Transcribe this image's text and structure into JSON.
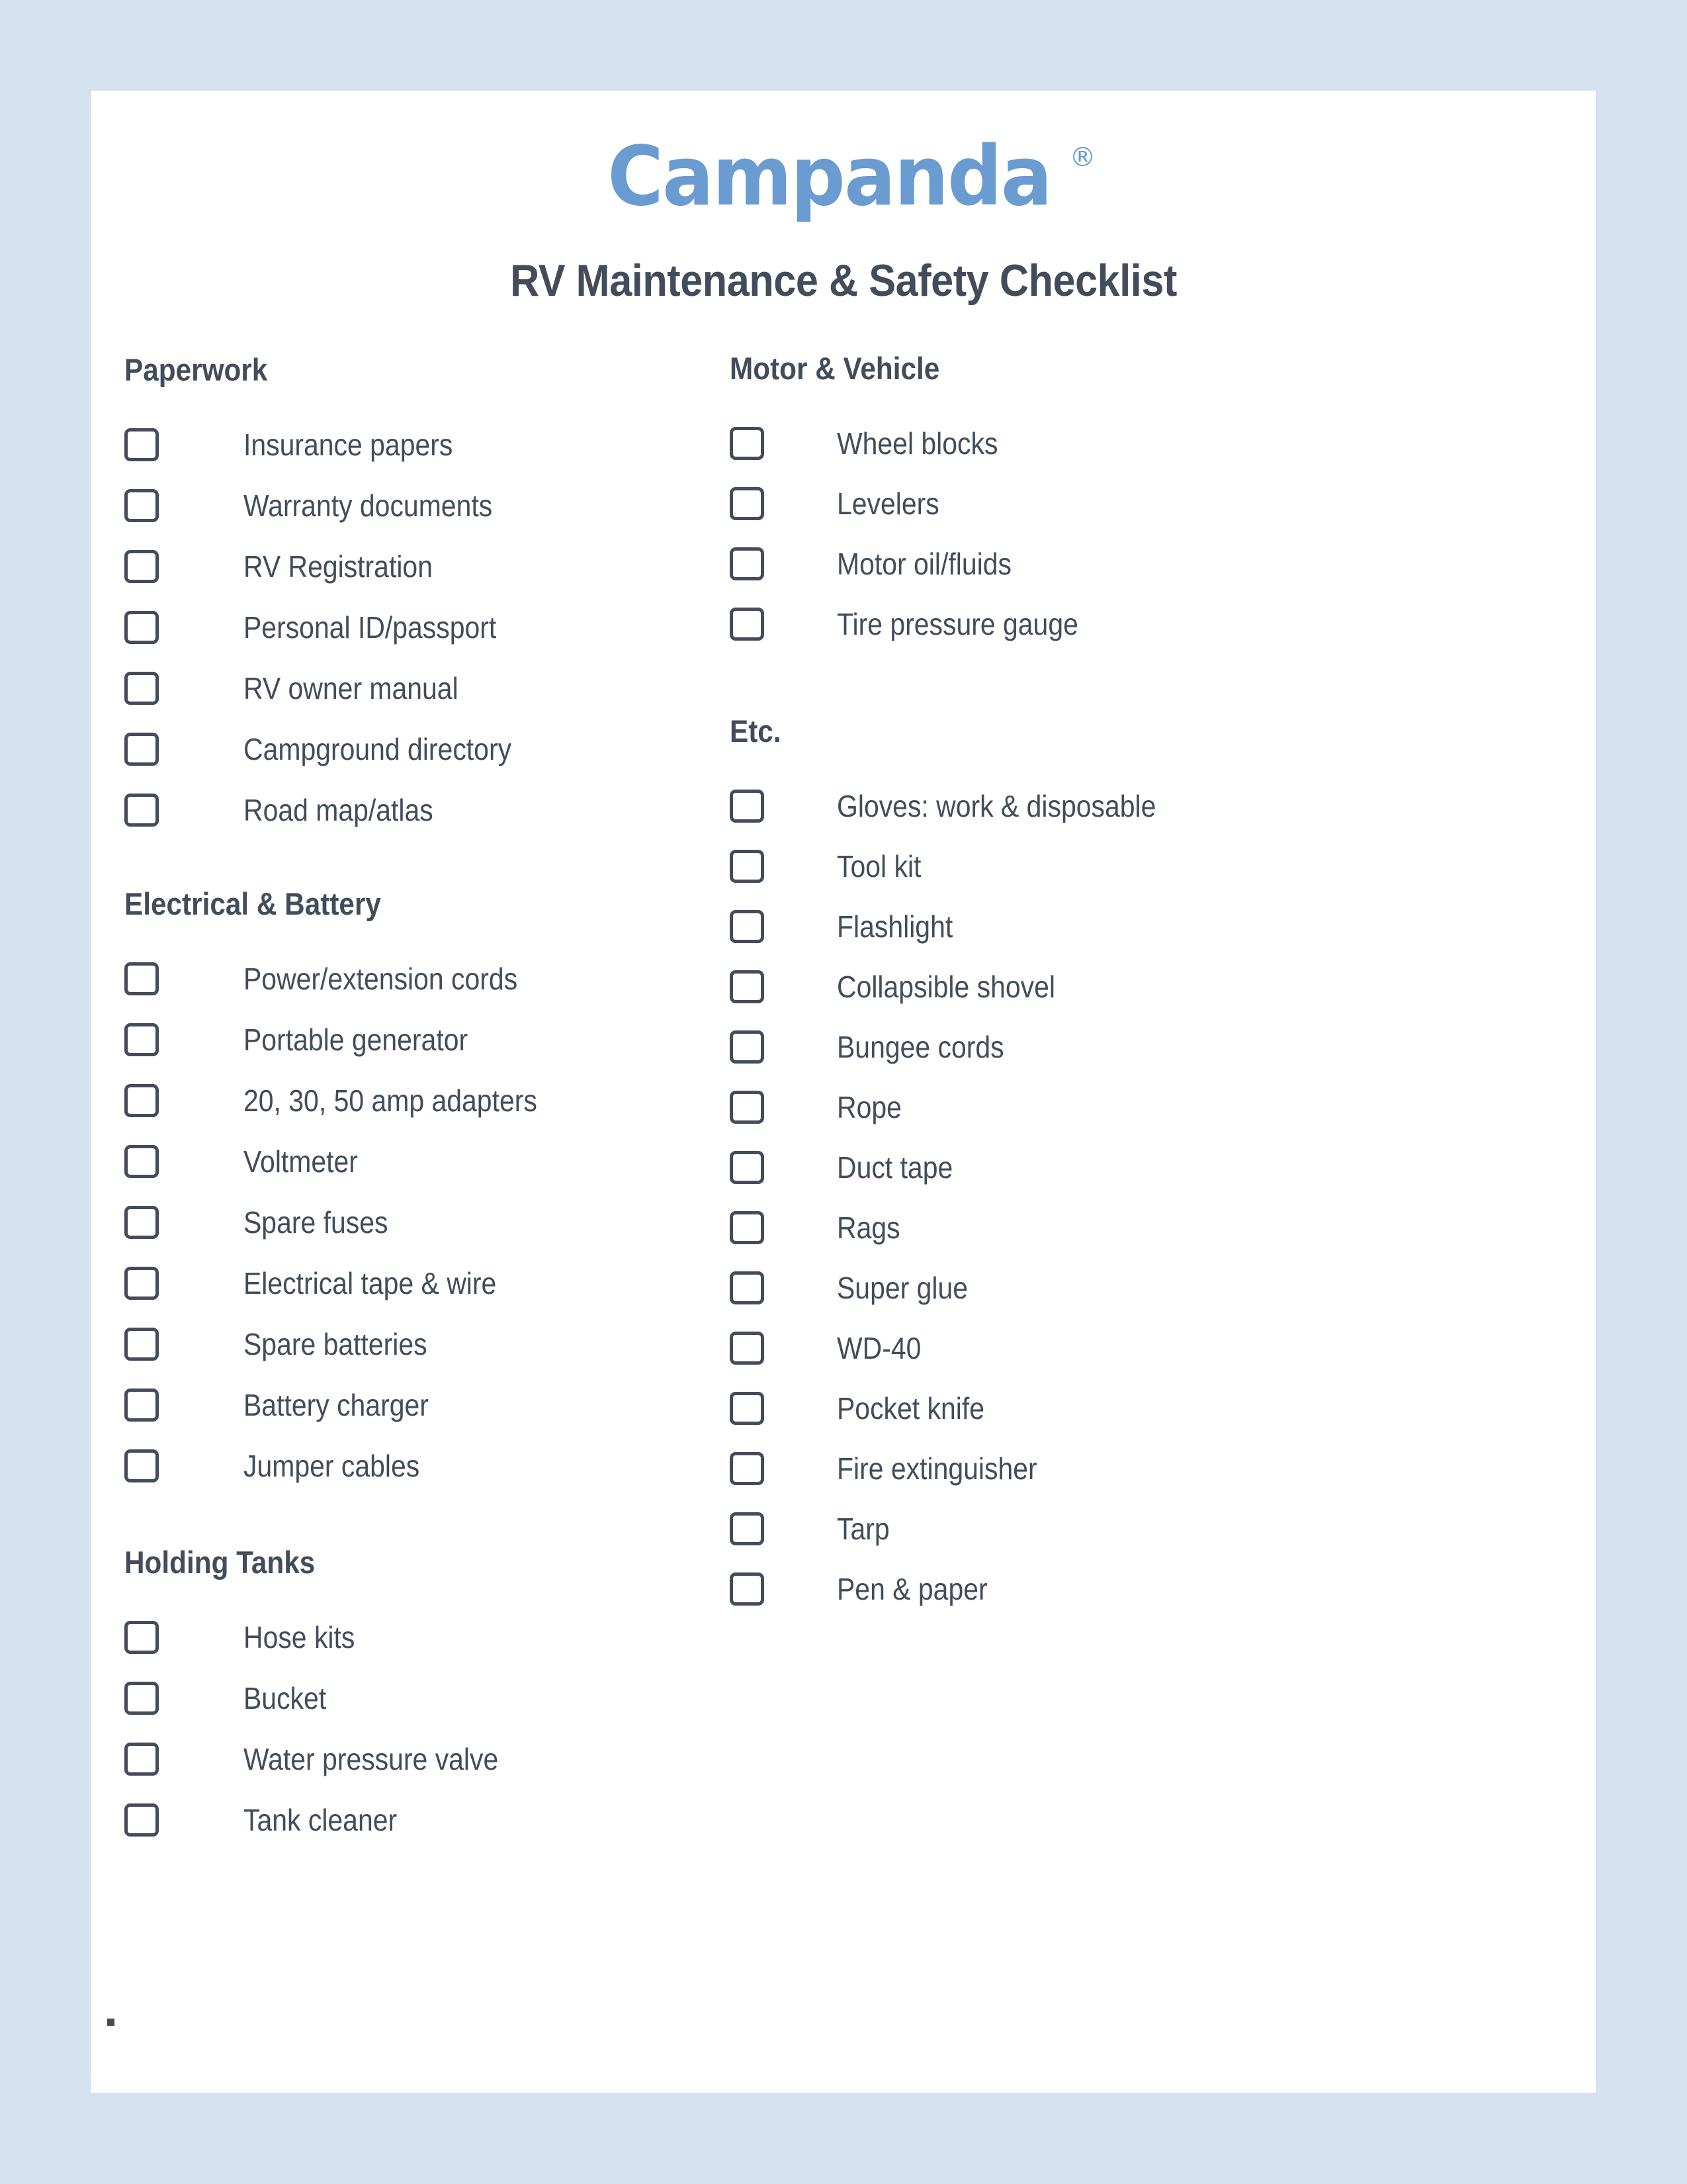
{
  "page": {
    "background_color": "#d5e2f0",
    "sheet_color": "#ffffff"
  },
  "brand": {
    "logo_text": "Campanda",
    "registered_mark": "®",
    "logo_color": "#6a9bd1"
  },
  "document": {
    "title": "RV Maintenance & Safety Checklist",
    "text_color": "#434c5a",
    "footer_mark": ""
  },
  "columns": {
    "left": {
      "sections": [
        {
          "title": "Paperwork",
          "items": [
            "Insurance papers",
            "Warranty documents",
            "RV Registration",
            "Personal ID/passport",
            "RV owner manual",
            "Campground directory",
            "Road map/atlas"
          ]
        },
        {
          "title": "Electrical & Battery",
          "items": [
            "Power/extension cords",
            "Portable generator",
            "20, 30, 50 amp adapters",
            "Voltmeter",
            "Spare fuses",
            "Electrical tape & wire",
            "Spare batteries",
            "Battery charger",
            "Jumper cables"
          ]
        },
        {
          "title": "Holding Tanks",
          "items": [
            "Hose kits",
            "Bucket",
            "Water pressure valve",
            "Tank cleaner"
          ]
        }
      ]
    },
    "right": {
      "sections": [
        {
          "title": "Motor & Vehicle",
          "items": [
            "Wheel blocks",
            "Levelers",
            "Motor oil/fluids",
            "Tire pressure gauge"
          ]
        },
        {
          "title": "Etc.",
          "items": [
            "Gloves: work & disposable",
            "Tool kit",
            "Flashlight",
            "Collapsible shovel",
            "Bungee cords",
            "Rope",
            "Duct tape",
            "Rags",
            "Super glue",
            "WD-40",
            "Pocket knife",
            "Fire extinguisher",
            "Tarp",
            "Pen & paper"
          ]
        }
      ]
    }
  }
}
